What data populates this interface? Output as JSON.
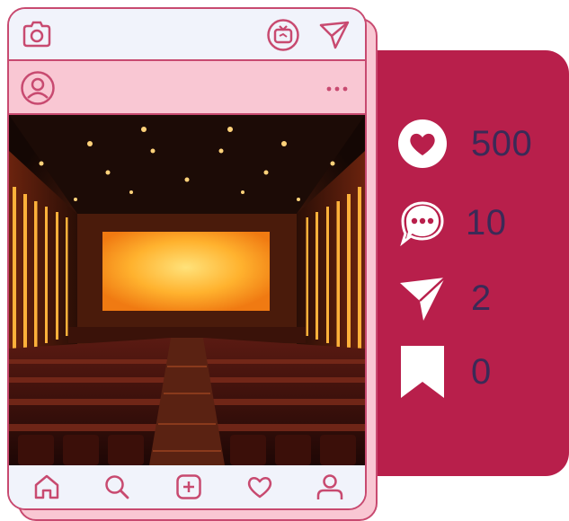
{
  "post": {
    "stats": {
      "likes": "500",
      "comments": "10",
      "shares": "2",
      "saves": "0"
    }
  },
  "icons": {
    "camera": "camera-icon",
    "igtv": "igtv-icon",
    "direct": "paper-plane-icon",
    "avatar": "user-avatar-icon",
    "more": "more-dots-icon",
    "home": "home-icon",
    "search": "search-icon",
    "add": "add-post-icon",
    "activity": "heart-icon",
    "profile": "profile-icon",
    "like": "heart-filled-icon",
    "comment": "comment-bubble-icon",
    "share": "send-arrow-icon",
    "save": "bookmark-icon"
  },
  "colors": {
    "accent": "#b81f4b",
    "outline": "#c84a70",
    "pink": "#f9c7d3",
    "card": "#f1f3fb",
    "stat_text": "#3b2a57"
  }
}
